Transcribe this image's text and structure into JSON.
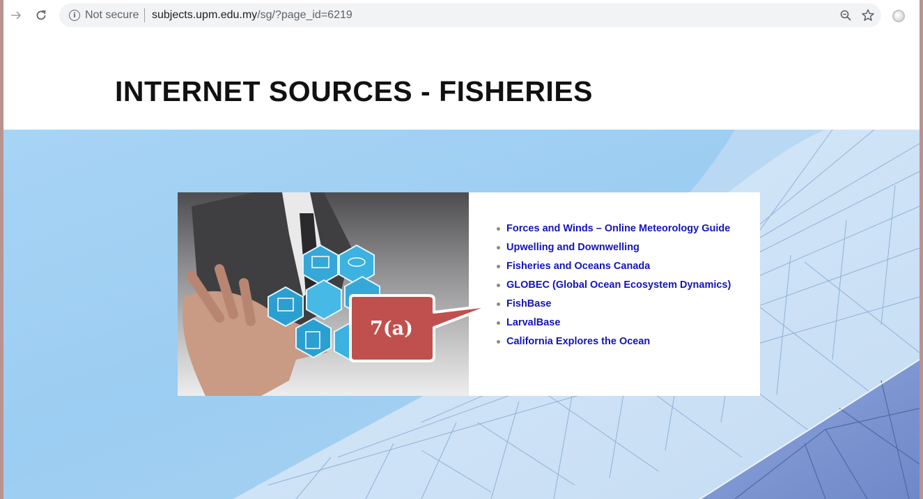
{
  "browser": {
    "security_label": "Not secure",
    "url_domain": "subjects.upm.edu.my",
    "url_path": "/sg/?page_id=6219",
    "back_icon": "arrow-right-icon",
    "reload_icon": "reload-icon",
    "zoom_icon": "zoom-out-icon",
    "bookmark_icon": "star-icon"
  },
  "page": {
    "title": "INTERNET SOURCES - FISHERIES"
  },
  "links": [
    "Forces and Winds – Online Meteorology Guide",
    "Upwelling and Downwelling",
    "Fisheries and Oceans Canada",
    "GLOBEC (Global Ocean Ecosystem Dynamics)",
    "FishBase",
    "LarvalBase",
    "California Explores the Ocean"
  ],
  "callout": {
    "label": "7(a)",
    "fill": "#c0504d",
    "border": "#ffffff"
  },
  "colors": {
    "link": "#1414b8",
    "hero_sky": "#a7d4f5"
  }
}
